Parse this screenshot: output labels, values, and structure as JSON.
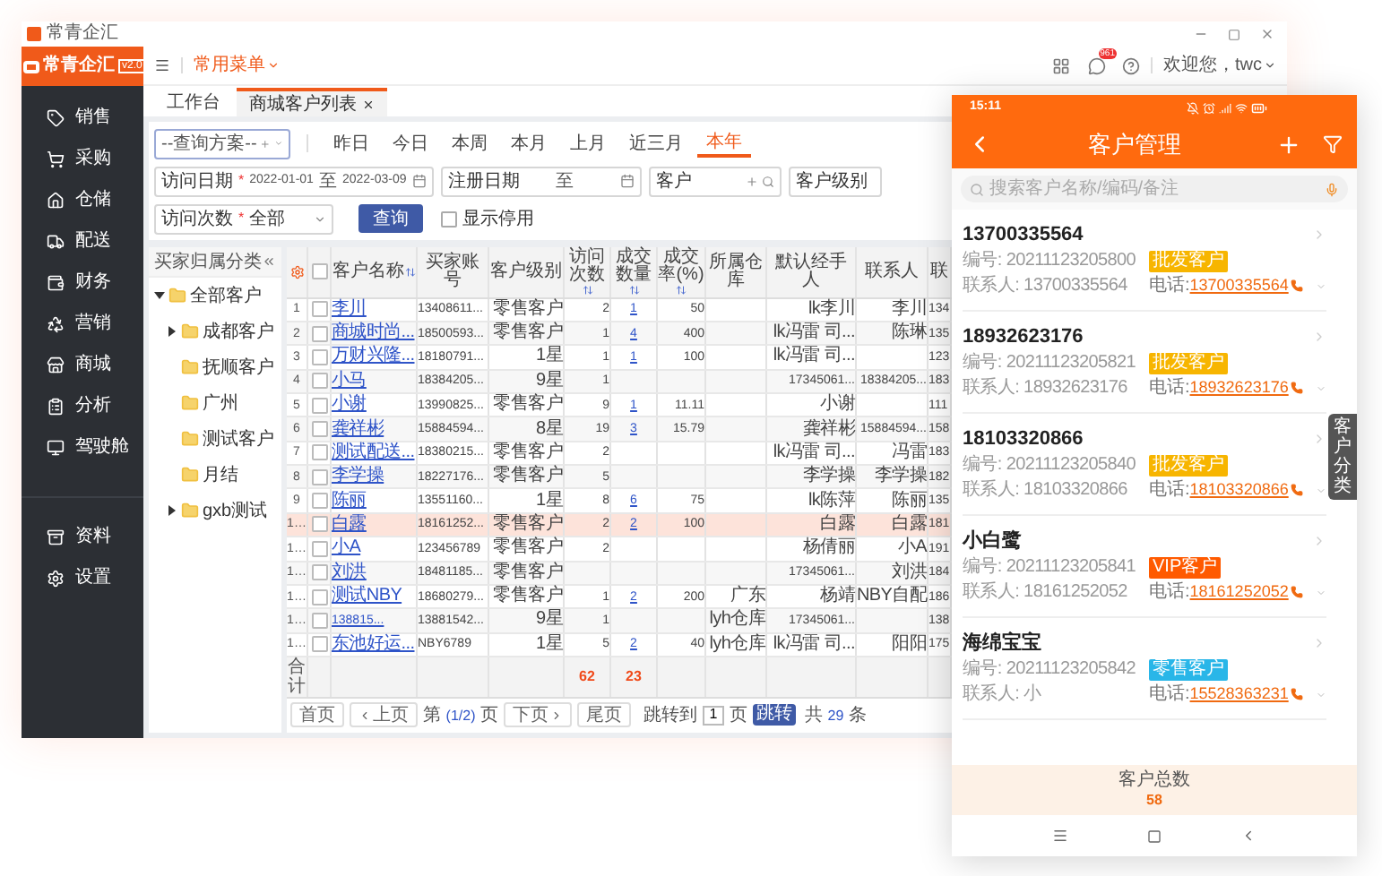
{
  "app_window": {
    "title": "常青企汇",
    "logo": "常青企汇",
    "version": "v2.0",
    "menu_label": "常用菜单",
    "notification_count": "961",
    "greeting": "欢迎您，twc"
  },
  "sidebar": {
    "main_items": [
      "销售",
      "采购",
      "仓储",
      "配送",
      "财务",
      "营销",
      "商城",
      "分析",
      "驾驶舱"
    ],
    "bottom_items": [
      "资料",
      "设置"
    ]
  },
  "tabs": [
    {
      "label": "工作台",
      "selected": false,
      "closable": false
    },
    {
      "label": "商城客户列表",
      "selected": true,
      "closable": true
    }
  ],
  "filters": {
    "scheme_placeholder": "--查询方案--",
    "quick_ranges": [
      {
        "label": "昨日",
        "selected": false
      },
      {
        "label": "今日",
        "selected": false
      },
      {
        "label": "本周",
        "selected": false
      },
      {
        "label": "本月",
        "selected": false
      },
      {
        "label": "上月",
        "selected": false
      },
      {
        "label": "近三月",
        "selected": false
      },
      {
        "label": "本年",
        "selected": true
      }
    ],
    "fields": [
      {
        "kind": "date_range",
        "label": "访问日期",
        "required_mark": "*",
        "from": "2022-01-01",
        "separator": "至",
        "to": "2022-03-09"
      },
      {
        "kind": "date_range",
        "label": "注册日期",
        "separator": "至"
      },
      {
        "kind": "lookup",
        "label": "客户"
      },
      {
        "kind": "text",
        "label": "客户级别"
      }
    ],
    "actions": [
      {
        "kind": "select",
        "label": "访问次数",
        "required_mark": "*",
        "value": "全部"
      },
      {
        "kind": "button",
        "label": "查询"
      },
      {
        "kind": "checkbox",
        "label": "显示停用",
        "checked": false
      }
    ]
  },
  "tree": {
    "title": "买家归属分类",
    "nodes": [
      {
        "label": "全部客户",
        "expanded": true,
        "children": [
          {
            "label": "成都客户",
            "expanded": false
          },
          {
            "label": "抚顺客户"
          },
          {
            "label": "广州"
          },
          {
            "label": "测试客户"
          },
          {
            "label": "月结"
          },
          {
            "label": "gxb测试",
            "expanded": false
          }
        ]
      }
    ]
  },
  "table": {
    "all_checked": false,
    "columns": [
      {
        "label": "客户名称",
        "sortable": true,
        "kind": "link"
      },
      {
        "label": "买家账号",
        "sortable": false,
        "kind": "text"
      },
      {
        "label": "客户级别",
        "sortable": false,
        "kind": "text"
      },
      {
        "label": "访问次数",
        "sortable": true,
        "kind": "text"
      },
      {
        "label": "成交数量",
        "sortable": true,
        "kind": "link"
      },
      {
        "label": "成交率(%)",
        "sortable": true,
        "kind": "text"
      },
      {
        "label": "所属仓库",
        "sortable": false,
        "kind": "text"
      },
      {
        "label": "默认经手人",
        "sortable": false,
        "kind": "text"
      },
      {
        "label": "联系人",
        "sortable": false,
        "kind": "text"
      },
      {
        "label": "联",
        "sortable": false,
        "kind": "text"
      }
    ],
    "rows": [
      {
        "index": "1",
        "selected": false,
        "checked": false,
        "cells": [
          "李川",
          "13408611...",
          "零售客户",
          "2",
          "1",
          "50",
          null,
          "lk李川",
          "李川",
          "134"
        ]
      },
      {
        "index": "2",
        "selected": false,
        "checked": false,
        "cells": [
          "商城时尚...",
          "18500593...",
          "零售客户",
          "1",
          "4",
          "400",
          null,
          "lk冯雷 司...",
          "陈琳",
          "135"
        ]
      },
      {
        "index": "3",
        "selected": false,
        "checked": false,
        "cells": [
          "万财兴隆...",
          "18180791...",
          "1星",
          "1",
          "1",
          "100",
          null,
          "lk冯雷 司...",
          null,
          "123"
        ]
      },
      {
        "index": "4",
        "selected": false,
        "checked": false,
        "cells": [
          "小马",
          "18384205...",
          "9星",
          "1",
          null,
          null,
          null,
          "17345061...",
          "18384205...",
          "183"
        ]
      },
      {
        "index": "5",
        "selected": false,
        "checked": false,
        "cells": [
          "小谢",
          "13990825...",
          "零售客户",
          "9",
          "1",
          "11.11",
          null,
          "小谢",
          null,
          "111"
        ]
      },
      {
        "index": "6",
        "selected": false,
        "checked": false,
        "cells": [
          "龚祥彬",
          "15884594...",
          "8星",
          "19",
          "3",
          "15.79",
          null,
          "龚祥彬",
          "15884594...",
          "158"
        ]
      },
      {
        "index": "7",
        "selected": false,
        "checked": false,
        "cells": [
          "测试配送...",
          "18380215...",
          "零售客户",
          "2",
          null,
          null,
          null,
          "lk冯雷 司...",
          "冯雷",
          "183"
        ]
      },
      {
        "index": "8",
        "selected": false,
        "checked": false,
        "cells": [
          "李学操",
          "18227176...",
          "零售客户",
          "5",
          null,
          null,
          null,
          "李学操",
          "李学操",
          "182"
        ]
      },
      {
        "index": "9",
        "selected": false,
        "checked": false,
        "cells": [
          "陈丽",
          "13551160...",
          "1星",
          "8",
          "6",
          "75",
          null,
          "lk陈萍",
          "陈丽",
          "135"
        ]
      },
      {
        "index": "1…",
        "selected": true,
        "checked": false,
        "cells": [
          "白露",
          "18161252...",
          "零售客户",
          "2",
          "2",
          "100",
          null,
          "白露",
          "白露",
          "181"
        ]
      },
      {
        "index": "1…",
        "selected": false,
        "checked": false,
        "cells": [
          "小A",
          "123456789",
          "零售客户",
          "2",
          null,
          null,
          null,
          "杨倩丽",
          "小A",
          "191"
        ]
      },
      {
        "index": "1…",
        "selected": false,
        "checked": false,
        "cells": [
          "刘洪",
          "18481185...",
          "零售客户",
          null,
          null,
          null,
          null,
          "17345061...",
          "刘洪",
          "184"
        ]
      },
      {
        "index": "1…",
        "selected": false,
        "checked": false,
        "cells": [
          "测试NBY",
          "18680279...",
          "零售客户",
          "1",
          "2",
          "200",
          "广东",
          "杨靖",
          "NBY自配",
          "186"
        ]
      },
      {
        "index": "1…",
        "selected": false,
        "checked": false,
        "cells": [
          "138815...",
          "13881542...",
          "9星",
          "1",
          null,
          null,
          "lyh仓库",
          "17345061...",
          null,
          "138"
        ]
      },
      {
        "index": "1…",
        "selected": false,
        "checked": false,
        "cells": [
          "东池好运...",
          "NBY6789",
          "1星",
          "5",
          "2",
          "40",
          "lyh仓库",
          "lk冯雷 司...",
          "阳阳",
          "175"
        ]
      }
    ],
    "totals": {
      "label": "合计",
      "cells": [
        null,
        null,
        null,
        "62",
        "23",
        null,
        null,
        null,
        null,
        null
      ]
    }
  },
  "pagination": {
    "first": "首页",
    "prev": "上页",
    "page_prefix": "第",
    "page": "(1/2)",
    "page_suffix": "页",
    "next": "下页",
    "last": "尾页",
    "jump_label": "跳转到",
    "jump_value": "1",
    "jump_suffix": "页",
    "jump_button": "跳转",
    "total_prefix": "共",
    "total_count": "29",
    "total_suffix": "条"
  },
  "phone": {
    "time": "15:11",
    "title": "客户管理",
    "search_placeholder": "搜索客户名称/编码/备注",
    "customers": [
      {
        "name": "13700335564",
        "code": "编号: 20211123205800",
        "tag": "批发客户",
        "color": "#f7b500",
        "contact": "联系人: 13700335564",
        "phone_label": "电话:",
        "phone": "13700335564"
      },
      {
        "name": "18932623176",
        "code": "编号: 20211123205821",
        "tag": "批发客户",
        "color": "#f7b500",
        "contact": "联系人: 18932623176",
        "phone_label": "电话:",
        "phone": "18932623176"
      },
      {
        "name": "18103320866",
        "code": "编号: 20211123205840",
        "tag": "批发客户",
        "color": "#f7b500",
        "contact": "联系人: 18103320866",
        "phone_label": "电话:",
        "phone": "18103320866"
      },
      {
        "name": "小白鹭",
        "code": "编号: 20211123205841",
        "tag": "VIP客户",
        "color": "#ff5a00",
        "contact": "联系人: 18161252052",
        "phone_label": "电话:",
        "phone": "18161252052"
      },
      {
        "name": "海绵宝宝",
        "code": "编号: 20211123205842",
        "tag": "零售客户",
        "color": "#29b6e8",
        "contact": "联系人: 小",
        "phone_label": "电话:",
        "phone": "15528363231"
      }
    ],
    "side_tab": "客户分类",
    "footer_label": "客户总数",
    "footer_count": "58"
  }
}
